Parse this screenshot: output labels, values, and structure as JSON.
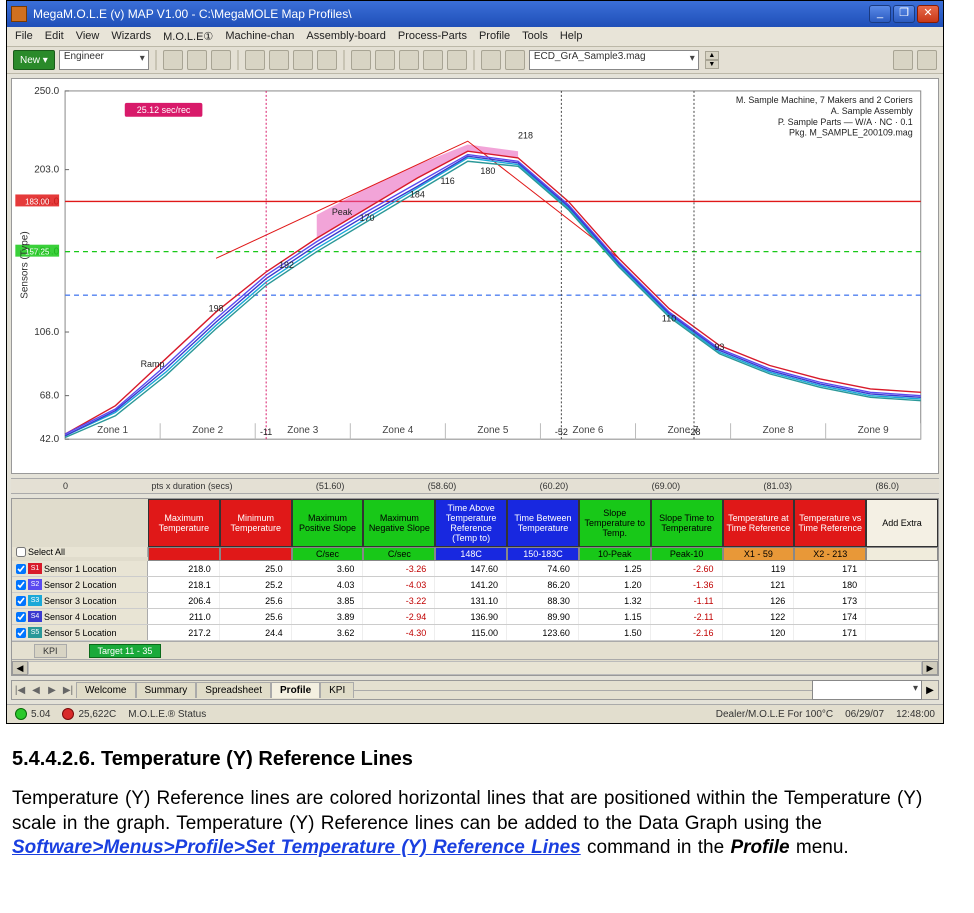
{
  "window": {
    "title": "MegaM.O.L.E (v) MAP V1.00 - C:\\MegaMOLE Map Profiles\\"
  },
  "menu": [
    "File",
    "Edit",
    "View",
    "Wizards",
    "M.O.L.E①",
    "Machine-chan",
    "Assembly-board",
    "Process-Parts",
    "Profile",
    "Tools",
    "Help"
  ],
  "toolbar": {
    "new_label": "New ▾",
    "engineer_combo": "Engineer",
    "profile_combo": "ECD_GrA_Sample3.mag"
  },
  "chart_data": {
    "type": "line",
    "xlabel": "pts x duration (secs)",
    "ylabel": "Sensors (Type)",
    "ylim": [
      42.0,
      250.0
    ],
    "y_ticks": [
      42.0,
      68.0,
      106.0,
      154.0,
      184.0,
      203.0,
      250.0
    ],
    "ref_lines": [
      {
        "value": 184.0,
        "color": "#e01818",
        "label": "183.00"
      },
      {
        "value": 154.0,
        "color": "#18c818",
        "dash": true,
        "label": "157.25"
      },
      {
        "value": 128.0,
        "color": "#5080f0",
        "dash": true
      }
    ],
    "vertical_markers": [
      {
        "x": 0.235,
        "label": "-11",
        "color": "#d81a6a"
      },
      {
        "x": 0.58,
        "label": "-52"
      },
      {
        "x": 0.735,
        "label": "-28"
      }
    ],
    "badge": "25.12 sec/rec",
    "info_box": [
      "M. Sample Machine, 7 Makers and 2 Coriers",
      "A. Sample Assembly",
      "P. Sample Parts — W/A · NC · 0.1",
      "Pkg. M_SAMPLE_200109.mag"
    ],
    "zones": [
      "Zone 1",
      "Zone 2",
      "Zone 3",
      "Zone 4",
      "Zone 5",
      "Zone 6",
      "Zone 7",
      "Zone 8",
      "Zone 9"
    ],
    "x_ruler": [
      "0",
      "pts x duration (secs)",
      "(51.60)",
      "(58.60)",
      "(60.20)",
      "(69.00)",
      "(81.03)",
      "(86.0)"
    ],
    "series_annotations": [
      "198",
      "192",
      "170",
      "184",
      "116",
      "180",
      "110",
      "93"
    ],
    "peak_label": "218",
    "series": [
      {
        "name": "S1",
        "color": "#d81a2a",
        "values": [
          45,
          62,
          90,
          118,
          142,
          162,
          180,
          198,
          214,
          210,
          184,
          150,
          120,
          98,
          86,
          78,
          72,
          70
        ]
      },
      {
        "name": "S2",
        "color": "#5a4af0",
        "values": [
          45,
          60,
          86,
          114,
          140,
          160,
          178,
          195,
          212,
          208,
          182,
          148,
          118,
          96,
          84,
          76,
          70,
          68
        ]
      },
      {
        "name": "S3",
        "color": "#1aa8d8",
        "values": [
          44,
          58,
          82,
          110,
          136,
          156,
          174,
          192,
          210,
          206,
          180,
          146,
          116,
          94,
          82,
          74,
          68,
          66
        ]
      },
      {
        "name": "S4",
        "color": "#3a3ad0",
        "values": [
          44,
          59,
          84,
          112,
          138,
          158,
          176,
          193,
          211,
          207,
          181,
          147,
          117,
          95,
          83,
          75,
          69,
          67
        ]
      },
      {
        "name": "S5",
        "color": "#2a9898",
        "values": [
          43,
          56,
          80,
          108,
          134,
          154,
          172,
          190,
          208,
          205,
          179,
          145,
          115,
          93,
          81,
          73,
          67,
          65
        ]
      }
    ],
    "band": {
      "start_idx": 5,
      "end_idx": 9,
      "low": [
        162,
        180,
        198,
        214,
        210
      ],
      "high": [
        176,
        192,
        206,
        218,
        214
      ],
      "color": "#e85ab8"
    }
  },
  "grid": {
    "headers": [
      {
        "label": "Maximum Temperature",
        "cls": "hdr-red"
      },
      {
        "label": "Minimum Temperature",
        "cls": "hdr-red"
      },
      {
        "label": "Maximum Positive Slope",
        "cls": "hdr-green"
      },
      {
        "label": "Maximum Negative Slope",
        "cls": "hdr-green"
      },
      {
        "label": "Time Above Temperature Reference (Temp to)",
        "cls": "hdr-blue"
      },
      {
        "label": "Time Between Temperature",
        "cls": "hdr-blue"
      },
      {
        "label": "Slope Temperature to Temp.",
        "cls": "hdr-green"
      },
      {
        "label": "Slope Time to Temperature",
        "cls": "hdr-green"
      },
      {
        "label": "Temperature at Time Reference",
        "cls": "hdr-red"
      },
      {
        "label": "Temperature vs Time Reference",
        "cls": "hdr-red"
      },
      {
        "label": "Add Extra",
        "cls": "hdr-plain"
      }
    ],
    "units": [
      {
        "label": "",
        "cls": "u-red"
      },
      {
        "label": "",
        "cls": "u-red"
      },
      {
        "label": "C/sec",
        "cls": "u-green"
      },
      {
        "label": "C/sec",
        "cls": "u-green"
      },
      {
        "label": "148C",
        "cls": "u-blue"
      },
      {
        "label": "150-183C",
        "cls": "u-blue"
      },
      {
        "label": "10-Peak",
        "cls": "u-green"
      },
      {
        "label": "Peak-10",
        "cls": "u-green"
      },
      {
        "label": "X1 - 59",
        "cls": "u-orange"
      },
      {
        "label": "X2 - 213",
        "cls": "u-orange"
      },
      {
        "label": "",
        "cls": "u-plain"
      }
    ],
    "select_all_label": "Select All",
    "rows": [
      {
        "swatch": "#d81a2a",
        "tag": "S1",
        "name": "Sensor 1 Location",
        "cells": [
          "218.0",
          "25.0",
          "3.60",
          "-3.26",
          "147.60",
          "74.60",
          "1.25",
          "-2.60",
          "119",
          "171"
        ]
      },
      {
        "swatch": "#5a4af0",
        "tag": "S2",
        "name": "Sensor 2 Location",
        "cells": [
          "218.1",
          "25.2",
          "4.03",
          "-4.03",
          "141.20",
          "86.20",
          "1.20",
          "-1.36",
          "121",
          "180"
        ]
      },
      {
        "swatch": "#1aa8d8",
        "tag": "S3",
        "name": "Sensor 3 Location",
        "cells": [
          "206.4",
          "25.6",
          "3.85",
          "-3.22",
          "131.10",
          "88.30",
          "1.32",
          "-1.11",
          "126",
          "173"
        ]
      },
      {
        "swatch": "#3a3ad0",
        "tag": "S4",
        "name": "Sensor 4 Location",
        "cells": [
          "211.0",
          "25.6",
          "3.89",
          "-2.94",
          "136.90",
          "89.90",
          "1.15",
          "-2.11",
          "122",
          "174"
        ]
      },
      {
        "swatch": "#2a9898",
        "tag": "S5",
        "name": "Sensor 5 Location",
        "cells": [
          "217.2",
          "24.4",
          "3.62",
          "-4.30",
          "115.00",
          "123.60",
          "1.50",
          "-2.16",
          "120",
          "171"
        ]
      }
    ],
    "target_tab_left": "KPI",
    "target_tab": "Target 11 - 35"
  },
  "sheets": {
    "tabs": [
      "Welcome",
      "Summary",
      "Spreadsheet",
      "Profile",
      "KPI"
    ],
    "active": 3
  },
  "status": {
    "left1": "5.04",
    "left2": "25,622C",
    "center": "M.O.L.E.® Status",
    "right1": "Dealer/M.O.L.E For 100°C",
    "right2": "06/29/07",
    "right3": "12:48:00"
  },
  "doc": {
    "heading": "5.4.4.2.6. Temperature (Y) Reference Lines",
    "body_part1": "Temperature (Y) Reference lines are colored horizontal lines that are positioned within the Temperature (Y) scale in the graph. Temperature (Y) Reference lines can be added to the Data Graph using the ",
    "link": "Software>Menus>Profile>Set Temperature (Y) Reference Lines",
    "body_part2": " command in the ",
    "menu_name": "Profile",
    "body_part3": " menu."
  }
}
